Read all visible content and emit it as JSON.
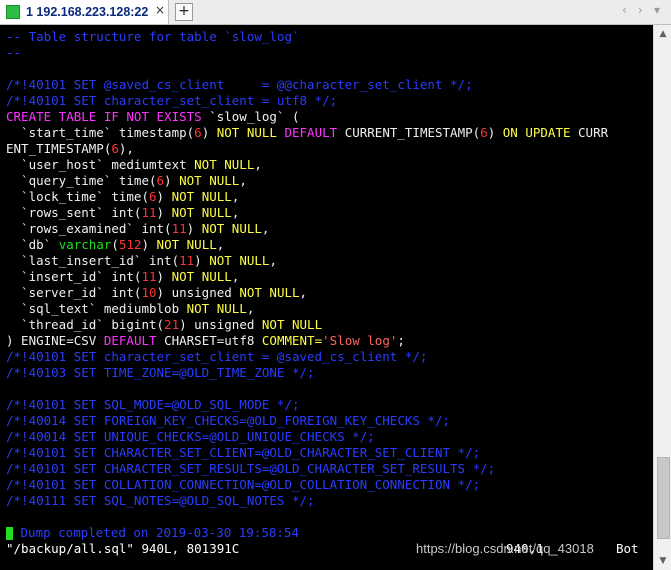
{
  "tabs": {
    "active_label": "1 192.168.223.128:22",
    "close_glyph": "×",
    "add_glyph": "+",
    "nav_left": "‹",
    "nav_right": "›",
    "nav_menu": "▾"
  },
  "colors": {
    "background": "#000000",
    "comment": "#2a3cff",
    "keyword": "#ff33ff",
    "number": "#ff3333",
    "type_keyword": "#ffff44",
    "string": "#ff6464",
    "text": "#f0f0f0",
    "cursor": "#22dd22"
  },
  "terminal_lines": [
    [
      {
        "t": "-- Table structure for table `slow_log`",
        "c": "comment"
      }
    ],
    [
      {
        "t": "--",
        "c": "comment"
      }
    ],
    [],
    [
      {
        "t": "/*!40101 SET @saved_cs_client     = @@character_set_client */;",
        "c": "comment"
      }
    ],
    [
      {
        "t": "/*!40101 SET character_set_client = utf8 */;",
        "c": "comment"
      }
    ],
    [
      {
        "t": "CREATE TABLE IF NOT EXISTS ",
        "c": "keyword"
      },
      {
        "t": "`slow_log` (",
        "c": "text"
      }
    ],
    [
      {
        "t": "  `start_time` timestamp(",
        "c": "text"
      },
      {
        "t": "6",
        "c": "number"
      },
      {
        "t": ") ",
        "c": "text"
      },
      {
        "t": "NOT NULL ",
        "c": "type_keyword"
      },
      {
        "t": "DEFAULT ",
        "c": "keyword"
      },
      {
        "t": "CURRENT_TIMESTAMP(",
        "c": "text"
      },
      {
        "t": "6",
        "c": "number"
      },
      {
        "t": ") ",
        "c": "text"
      },
      {
        "t": "ON UPDATE ",
        "c": "type_keyword"
      },
      {
        "t": "CURR",
        "c": "text"
      }
    ],
    [
      {
        "t": "ENT_TIMESTAMP(",
        "c": "text"
      },
      {
        "t": "6",
        "c": "number"
      },
      {
        "t": "),",
        "c": "text"
      }
    ],
    [
      {
        "t": "  `user_host` mediumtext ",
        "c": "text"
      },
      {
        "t": "NOT NULL",
        "c": "type_keyword"
      },
      {
        "t": ",",
        "c": "text"
      }
    ],
    [
      {
        "t": "  `query_time` time(",
        "c": "text"
      },
      {
        "t": "6",
        "c": "number"
      },
      {
        "t": ") ",
        "c": "text"
      },
      {
        "t": "NOT NULL",
        "c": "type_keyword"
      },
      {
        "t": ",",
        "c": "text"
      }
    ],
    [
      {
        "t": "  `lock_time` time(",
        "c": "text"
      },
      {
        "t": "6",
        "c": "number"
      },
      {
        "t": ") ",
        "c": "text"
      },
      {
        "t": "NOT NULL",
        "c": "type_keyword"
      },
      {
        "t": ",",
        "c": "text"
      }
    ],
    [
      {
        "t": "  `rows_sent` int(",
        "c": "text"
      },
      {
        "t": "11",
        "c": "number"
      },
      {
        "t": ") ",
        "c": "text"
      },
      {
        "t": "NOT NULL",
        "c": "type_keyword"
      },
      {
        "t": ",",
        "c": "text"
      }
    ],
    [
      {
        "t": "  `rows_examined` int(",
        "c": "text"
      },
      {
        "t": "11",
        "c": "number"
      },
      {
        "t": ") ",
        "c": "text"
      },
      {
        "t": "NOT NULL",
        "c": "type_keyword"
      },
      {
        "t": ",",
        "c": "text"
      }
    ],
    [
      {
        "t": "  `db` ",
        "c": "text"
      },
      {
        "t": "varchar",
        "c": "cursor"
      },
      {
        "t": "(",
        "c": "text"
      },
      {
        "t": "512",
        "c": "number"
      },
      {
        "t": ") ",
        "c": "text"
      },
      {
        "t": "NOT NULL",
        "c": "type_keyword"
      },
      {
        "t": ",",
        "c": "text"
      }
    ],
    [
      {
        "t": "  `last_insert_id` int(",
        "c": "text"
      },
      {
        "t": "11",
        "c": "number"
      },
      {
        "t": ") ",
        "c": "text"
      },
      {
        "t": "NOT NULL",
        "c": "type_keyword"
      },
      {
        "t": ",",
        "c": "text"
      }
    ],
    [
      {
        "t": "  `insert_id` int(",
        "c": "text"
      },
      {
        "t": "11",
        "c": "number"
      },
      {
        "t": ") ",
        "c": "text"
      },
      {
        "t": "NOT NULL",
        "c": "type_keyword"
      },
      {
        "t": ",",
        "c": "text"
      }
    ],
    [
      {
        "t": "  `server_id` int(",
        "c": "text"
      },
      {
        "t": "10",
        "c": "number"
      },
      {
        "t": ") unsigned ",
        "c": "text"
      },
      {
        "t": "NOT NULL",
        "c": "type_keyword"
      },
      {
        "t": ",",
        "c": "text"
      }
    ],
    [
      {
        "t": "  `sql_text` mediumblob ",
        "c": "text"
      },
      {
        "t": "NOT NULL",
        "c": "type_keyword"
      },
      {
        "t": ",",
        "c": "text"
      }
    ],
    [
      {
        "t": "  `thread_id` bigint(",
        "c": "text"
      },
      {
        "t": "21",
        "c": "number"
      },
      {
        "t": ") unsigned ",
        "c": "text"
      },
      {
        "t": "NOT NULL",
        "c": "type_keyword"
      }
    ],
    [
      {
        "t": ") ENGINE=CSV ",
        "c": "text"
      },
      {
        "t": "DEFAULT ",
        "c": "keyword"
      },
      {
        "t": "CHARSET=utf8 ",
        "c": "text"
      },
      {
        "t": "COMMENT=",
        "c": "type_keyword"
      },
      {
        "t": "'Slow log'",
        "c": "string"
      },
      {
        "t": ";",
        "c": "text"
      }
    ],
    [
      {
        "t": "/*!40101 SET character_set_client = @saved_cs_client */;",
        "c": "comment"
      }
    ],
    [
      {
        "t": "/*!40103 SET TIME_ZONE=@OLD_TIME_ZONE */;",
        "c": "comment"
      }
    ],
    [],
    [
      {
        "t": "/*!40101 SET SQL_MODE=@OLD_SQL_MODE */;",
        "c": "comment"
      }
    ],
    [
      {
        "t": "/*!40014 SET FOREIGN_KEY_CHECKS=@OLD_FOREIGN_KEY_CHECKS */;",
        "c": "comment"
      }
    ],
    [
      {
        "t": "/*!40014 SET UNIQUE_CHECKS=@OLD_UNIQUE_CHECKS */;",
        "c": "comment"
      }
    ],
    [
      {
        "t": "/*!40101 SET CHARACTER_SET_CLIENT=@OLD_CHARACTER_SET_CLIENT */;",
        "c": "comment"
      }
    ],
    [
      {
        "t": "/*!40101 SET CHARACTER_SET_RESULTS=@OLD_CHARACTER_SET_RESULTS */;",
        "c": "comment"
      }
    ],
    [
      {
        "t": "/*!40101 SET COLLATION_CONNECTION=@OLD_COLLATION_CONNECTION */;",
        "c": "comment"
      }
    ],
    [
      {
        "t": "/*!40111 SET SQL_NOTES=@OLD_SQL_NOTES */;",
        "c": "comment"
      }
    ],
    [],
    [
      {
        "t": "-",
        "c": "cursor_block"
      },
      {
        "t": " Dump completed on 2019-03-30 19:58:54",
        "c": "comment"
      }
    ]
  ],
  "status": {
    "file_info": "\"/backup/all.sql\" 940L, 801391C",
    "position": "940,1",
    "percent": "Bot"
  },
  "watermark": "https://blog.csdn.net/qq_43018"
}
